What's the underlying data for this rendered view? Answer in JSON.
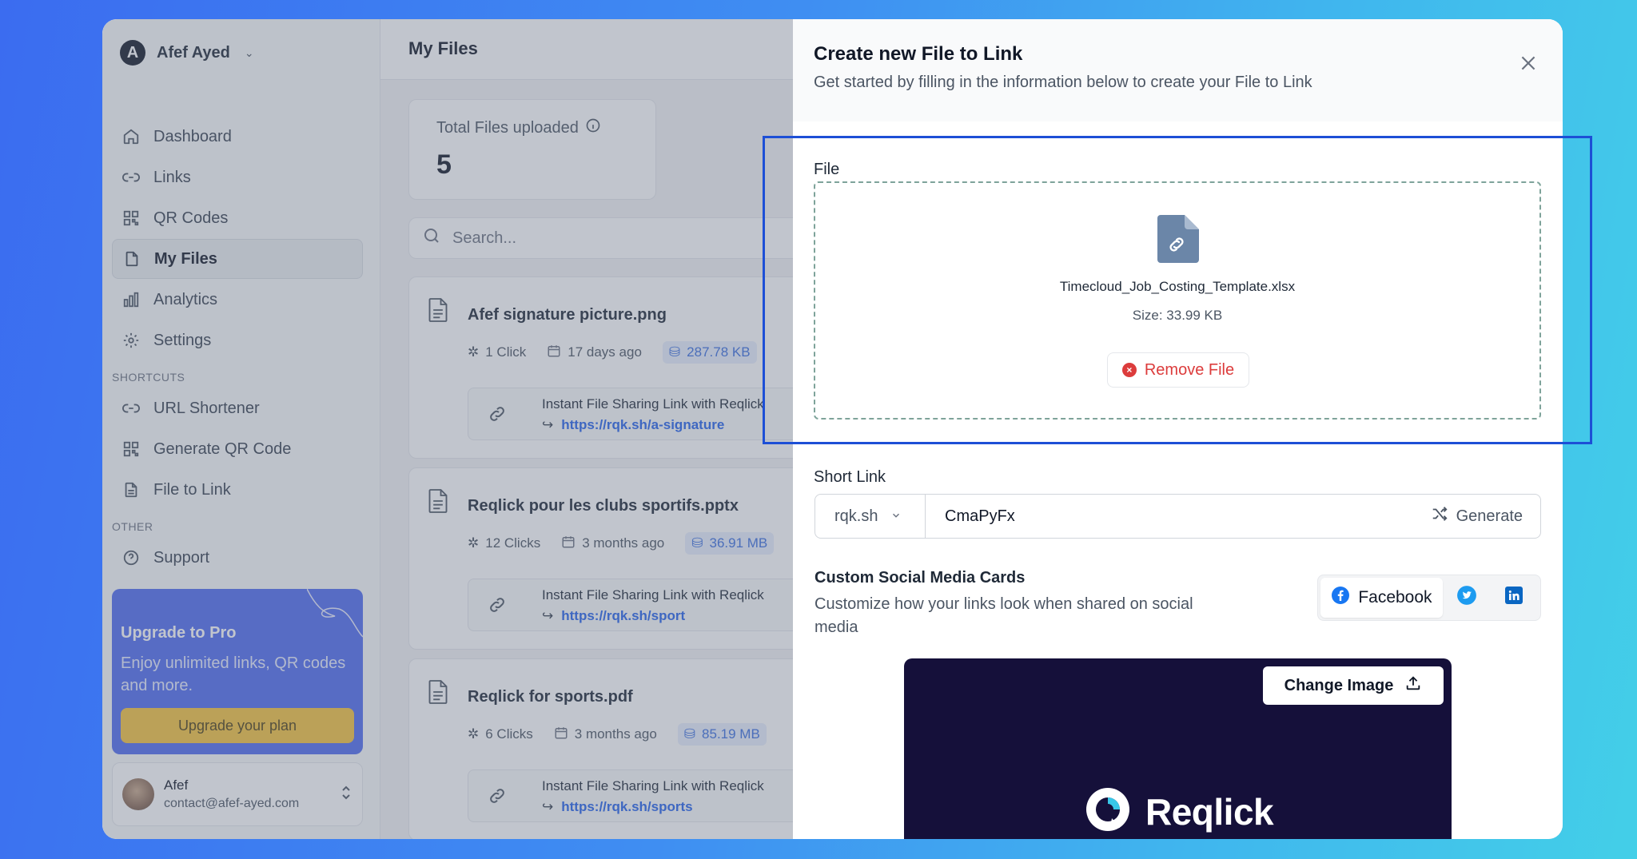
{
  "sidebar": {
    "user_name": "Afef Ayed",
    "items": [
      {
        "label": "Dashboard",
        "icon": "home-icon"
      },
      {
        "label": "Links",
        "icon": "link-icon"
      },
      {
        "label": "QR Codes",
        "icon": "qr-icon"
      },
      {
        "label": "My Files",
        "icon": "file-icon",
        "active": true
      },
      {
        "label": "Analytics",
        "icon": "chart-icon"
      },
      {
        "label": "Settings",
        "icon": "gear-icon"
      }
    ],
    "shortcuts_label": "SHORTCUTS",
    "shortcuts": [
      {
        "label": "URL Shortener",
        "icon": "link-icon"
      },
      {
        "label": "Generate QR Code",
        "icon": "qr-icon"
      },
      {
        "label": "File to Link",
        "icon": "file-text-icon"
      }
    ],
    "other_label": "OTHER",
    "other": [
      {
        "label": "Support",
        "icon": "help-icon"
      }
    ],
    "upgrade": {
      "title": "Upgrade to Pro",
      "text": "Enjoy unlimited links, QR codes and more.",
      "button": "Upgrade your plan"
    },
    "account": {
      "name": "Afef",
      "email": "contact@afef-ayed.com"
    }
  },
  "main": {
    "title": "My Files",
    "stat_label": "Total Files uploaded",
    "stat_value": "5",
    "search_placeholder": "Search...",
    "files": [
      {
        "name": "Afef signature picture.png",
        "clicks": "1 Click",
        "age": "17 days ago",
        "size": "287.78 KB",
        "link_title": "Instant File Sharing Link with Reqlick",
        "url": "https://rqk.sh/a-signature"
      },
      {
        "name": "Reqlick pour les clubs sportifs.pptx",
        "clicks": "12 Clicks",
        "age": "3 months ago",
        "size": "36.91 MB",
        "link_title": "Instant File Sharing Link with Reqlick",
        "url": "https://rqk.sh/sport"
      },
      {
        "name": "Reqlick for sports.pdf",
        "clicks": "6 Clicks",
        "age": "3 months ago",
        "size": "85.19 MB",
        "link_title": "Instant File Sharing Link with Reqlick",
        "url": "https://rqk.sh/sports"
      }
    ]
  },
  "panel": {
    "title": "Create new File to Link",
    "subtitle": "Get started by filling in the information below to create your File to Link",
    "file_label": "File",
    "file_name": "Timecloud_Job_Costing_Template.xlsx",
    "file_size": "Size: 33.99 KB",
    "remove_label": "Remove File",
    "short_link_label": "Short Link",
    "domain": "rqk.sh",
    "slug": "CmaPyFx",
    "generate_label": "Generate",
    "social_title": "Custom Social Media Cards",
    "social_desc": "Customize how your links look when shared on social media",
    "social_tabs": {
      "facebook": "Facebook"
    },
    "change_image_label": "Change Image",
    "brand_name": "Reqlick"
  },
  "colors": {
    "accent": "#2563eb",
    "danger": "#dc3c3c",
    "upgrade_bg": "#4f6bf0",
    "upgrade_button": "#f6c43d",
    "preview_bg": "#15103a"
  }
}
